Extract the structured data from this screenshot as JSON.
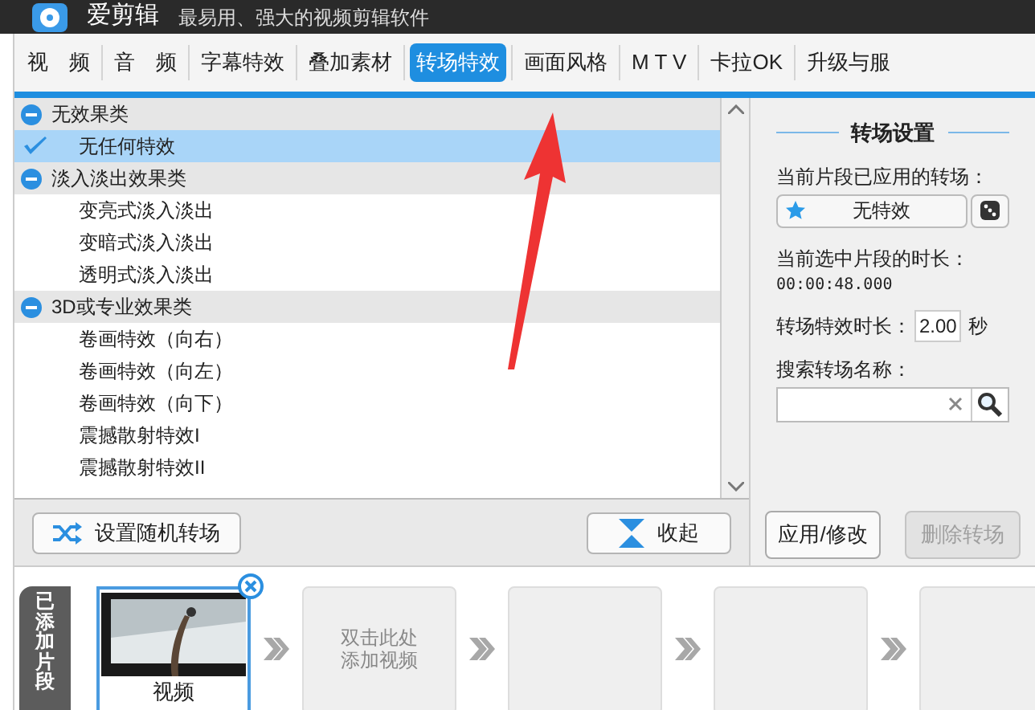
{
  "window": {
    "app_name": "爱剪辑",
    "tagline": "最易用、强大的视频剪辑软件"
  },
  "tabs": [
    {
      "label": "视　频",
      "selected": false
    },
    {
      "label": "音　频",
      "selected": false
    },
    {
      "label": "字幕特效",
      "selected": false
    },
    {
      "label": "叠加素材",
      "selected": false
    },
    {
      "label": "转场特效",
      "selected": true
    },
    {
      "label": "画面风格",
      "selected": false
    },
    {
      "label": "M T V",
      "selected": false
    },
    {
      "label": "卡拉OK",
      "selected": false
    },
    {
      "label": "升级与服",
      "selected": false
    }
  ],
  "effects": [
    {
      "label": "无效果类",
      "expanded": true,
      "children": [
        {
          "label": "无任何特效",
          "selected": true
        }
      ]
    },
    {
      "label": "淡入淡出效果类",
      "expanded": true,
      "children": [
        {
          "label": "变亮式淡入淡出",
          "selected": false
        },
        {
          "label": "变暗式淡入淡出",
          "selected": false
        },
        {
          "label": "透明式淡入淡出",
          "selected": false
        }
      ]
    },
    {
      "label": "3D或专业效果类",
      "expanded": true,
      "children": [
        {
          "label": "卷画特效（向右）",
          "selected": false
        },
        {
          "label": "卷画特效（向左）",
          "selected": false
        },
        {
          "label": "卷画特效（向下）",
          "selected": false
        },
        {
          "label": "震撼散射特效I",
          "selected": false
        },
        {
          "label": "震撼散射特效II",
          "selected": false
        }
      ]
    }
  ],
  "list_buttons": [
    {
      "kind": "random",
      "label": "设置随机转场"
    },
    {
      "kind": "collapse",
      "label": "收起"
    }
  ],
  "settings": {
    "title": "转场设置",
    "applied_label": "当前片段已应用的转场：",
    "applied_value": "无特效",
    "duration_label": "当前选中片段的时长：",
    "duration_value": "00:00:48.000",
    "effect_duration_label": "转场特效时长：",
    "effect_duration_value": "2.00",
    "effect_duration_unit": "秒",
    "search_label": "搜索转场名称：",
    "apply_button": {
      "label": "应用/修改",
      "disabled": false
    },
    "delete_button": {
      "label": "删除转场",
      "disabled": true
    }
  },
  "timeline": {
    "label": "已添加片段",
    "clips": [
      {
        "kind": "video",
        "label": "视频"
      },
      {
        "kind": "empty",
        "lines": [
          "双击此处",
          "添加视频"
        ]
      },
      {
        "kind": "empty"
      },
      {
        "kind": "empty"
      },
      {
        "kind": "empty"
      }
    ]
  }
}
